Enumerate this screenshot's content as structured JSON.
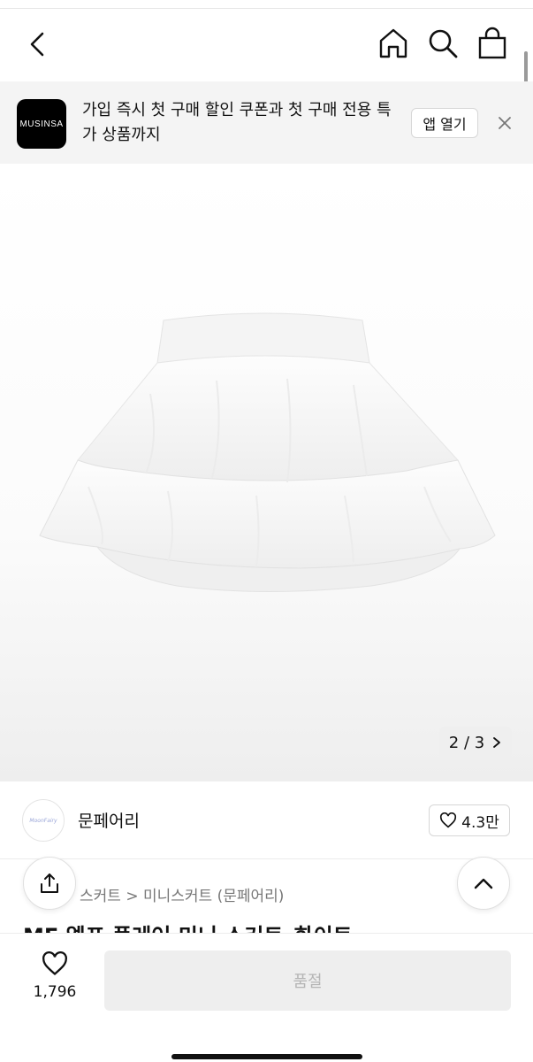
{
  "banner": {
    "logo_text": "MUSINSA",
    "message": "가입 즉시 첫 구매 할인 쿠폰과 첫 구매 전용 특가 상품까지",
    "open_app_label": "앱 열기"
  },
  "gallery": {
    "pager_text": "2 / 3"
  },
  "brand": {
    "avatar_text": "MoonFairy",
    "name": "문페어리",
    "likes": "4.3만"
  },
  "product": {
    "breadcrumb": "스커트 > 미니스커트 (문페어리)",
    "title": "MF 엘프 플레어 미니 스커트_화이트"
  },
  "bottom_bar": {
    "wish_count": "1,796",
    "cta_label": "품절"
  },
  "icons": [
    "back-icon",
    "home-icon",
    "search-icon",
    "bag-icon",
    "close-icon",
    "chevron-right-icon",
    "heart-icon",
    "share-icon",
    "chevron-up-icon"
  ]
}
